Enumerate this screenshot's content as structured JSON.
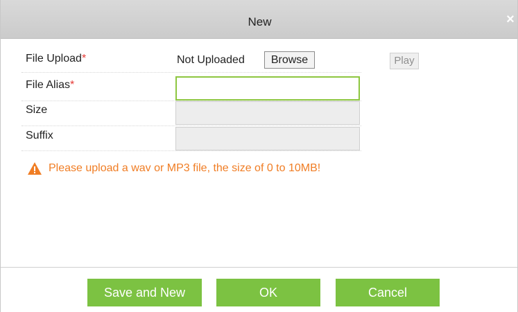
{
  "dialog": {
    "title": "New",
    "close_icon": "close-icon",
    "close_glyph": "×"
  },
  "form": {
    "file_upload": {
      "label": "File Upload",
      "required_mark": "*",
      "status": "Not Uploaded",
      "browse_label": "Browse",
      "play_label": "Play"
    },
    "file_alias": {
      "label": "File Alias",
      "required_mark": "*",
      "value": ""
    },
    "size": {
      "label": "Size",
      "value": ""
    },
    "suffix": {
      "label": "Suffix",
      "value": ""
    }
  },
  "warning": {
    "icon": "warning-triangle-icon",
    "text": "Please upload a wav or MP3 file, the size of 0 to 10MB!"
  },
  "footer": {
    "save_and_new_label": "Save and New",
    "ok_label": "OK",
    "cancel_label": "Cancel"
  },
  "colors": {
    "accent_green": "#7cc242",
    "focus_border": "#8dc63f",
    "warning_orange": "#f07d24",
    "required_red": "#e53935",
    "titlebar_gray": "#d2d2d2"
  }
}
